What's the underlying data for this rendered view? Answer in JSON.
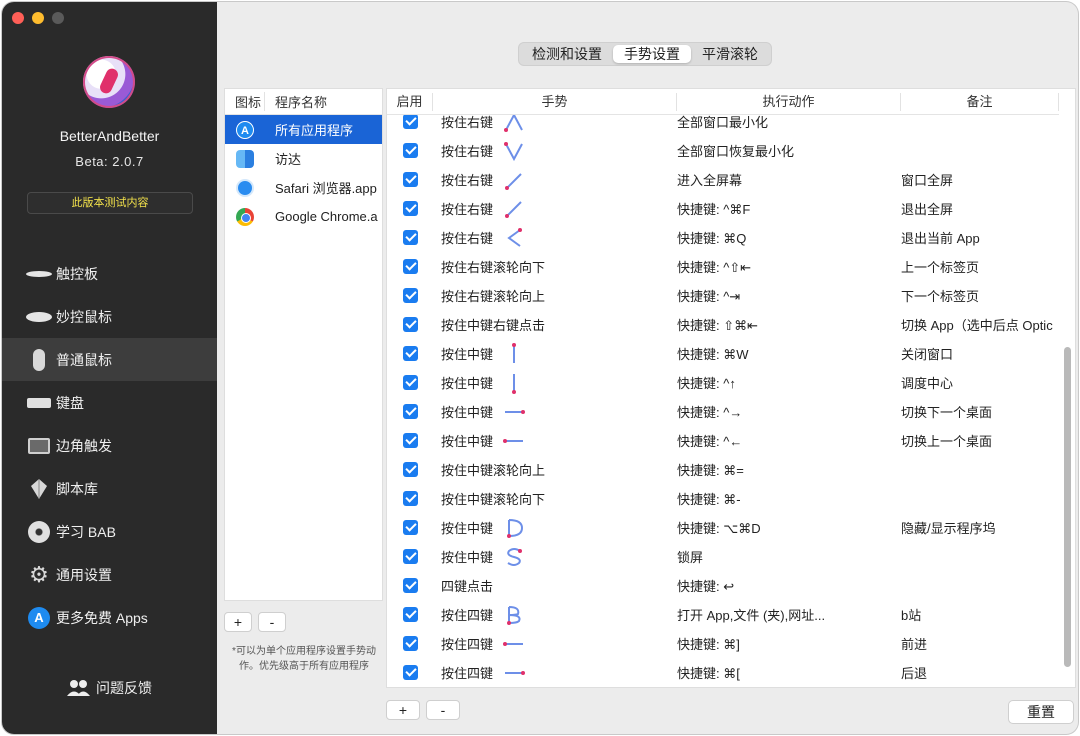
{
  "sidebar": {
    "app_name": "BetterAndBetter",
    "version": "Beta: 2.0.7",
    "test_button": "此版本测试内容",
    "items": [
      {
        "label": "触控板",
        "icon": "trackpad-icon"
      },
      {
        "label": "妙控鼠标",
        "icon": "magic-mouse-icon"
      },
      {
        "label": "普通鼠标",
        "icon": "mouse-icon",
        "active": true
      },
      {
        "label": "键盘",
        "icon": "keyboard-icon"
      },
      {
        "label": "边角触发",
        "icon": "hot-corner-icon"
      },
      {
        "label": "脚本库",
        "icon": "script-icon"
      },
      {
        "label": "学习 BAB",
        "icon": "learn-icon"
      },
      {
        "label": "通用设置",
        "icon": "gear-icon"
      },
      {
        "label": "更多免费 Apps",
        "icon": "appstore-icon"
      }
    ],
    "feedback": "问题反馈"
  },
  "tabs": [
    {
      "label": "检测和设置"
    },
    {
      "label": "手势设置",
      "active": true
    },
    {
      "label": "平滑滚轮"
    }
  ],
  "app_list": {
    "header_icon": "图标",
    "header_name": "程序名称",
    "apps": [
      {
        "name": "所有应用程序",
        "icon": "appstore-icon",
        "selected": true
      },
      {
        "name": "访达",
        "icon": "finder-icon"
      },
      {
        "name": "Safari 浏览器.app",
        "icon": "safari-icon"
      },
      {
        "name": "Google Chrome.a",
        "icon": "chrome-icon"
      }
    ],
    "add_label": "+",
    "remove_label": "-",
    "note": "*可以为单个应用程序设置手势动作。优先级高于所有应用程序"
  },
  "gesture_table": {
    "headers": {
      "enabled": "启用",
      "gesture": "手势",
      "action": "执行动作",
      "remark": "备注"
    },
    "rows": [
      {
        "gesture": "按住右键",
        "glyph": "up-v",
        "action": "全部窗口最小化",
        "remark": ""
      },
      {
        "gesture": "按住右键",
        "glyph": "down-v",
        "action": "全部窗口恢复最小化",
        "remark": ""
      },
      {
        "gesture": "按住右键",
        "glyph": "diag-up",
        "action": "进入全屏幕",
        "remark": "窗口全屏"
      },
      {
        "gesture": "按住右键",
        "glyph": "diag-down",
        "action": "快捷键: ^⌘F",
        "remark": "退出全屏"
      },
      {
        "gesture": "按住右键",
        "glyph": "left-v",
        "action": "快捷键: ⌘Q",
        "remark": "退出当前 App"
      },
      {
        "gesture": "按住右键滚轮向下",
        "glyph": "",
        "action": "快捷键: ^⇧⇤",
        "remark": "上一个标签页"
      },
      {
        "gesture": "按住右键滚轮向上",
        "glyph": "",
        "action": "快捷键: ^⇥",
        "remark": "下一个标签页"
      },
      {
        "gesture": "按住中键右键点击",
        "glyph": "",
        "action": "快捷键: ⇧⌘⇤",
        "remark": "切换 App（选中后点 Optic"
      },
      {
        "gesture": "按住中键",
        "glyph": "line-down",
        "action": "快捷键: ⌘W",
        "remark": "关闭窗口"
      },
      {
        "gesture": "按住中键",
        "glyph": "line-up",
        "action": "快捷键: ^↑",
        "remark": "调度中心"
      },
      {
        "gesture": "按住中键",
        "glyph": "line-right",
        "action": "快捷键: ^→",
        "remark": "切换下一个桌面"
      },
      {
        "gesture": "按住中键",
        "glyph": "line-left",
        "action": "快捷键: ^←",
        "remark": "切换上一个桌面"
      },
      {
        "gesture": "按住中键滚轮向上",
        "glyph": "",
        "action": "快捷键: ⌘=",
        "remark": ""
      },
      {
        "gesture": "按住中键滚轮向下",
        "glyph": "",
        "action": "快捷键: ⌘-",
        "remark": ""
      },
      {
        "gesture": "按住中键",
        "glyph": "letter-D",
        "action": "快捷键: ⌥⌘D",
        "remark": "隐藏/显示程序坞"
      },
      {
        "gesture": "按住中键",
        "glyph": "letter-S",
        "action": "锁屏",
        "remark": ""
      },
      {
        "gesture": "四键点击",
        "glyph": "",
        "action": "快捷键: ↩",
        "remark": ""
      },
      {
        "gesture": "按住四键",
        "glyph": "letter-B",
        "action": "打开 App,文件 (夹),网址...",
        "remark": "b站"
      },
      {
        "gesture": "按住四键",
        "glyph": "line-left",
        "action": "快捷键: ⌘]",
        "remark": "前进"
      },
      {
        "gesture": "按住四键",
        "glyph": "line-right",
        "action": "快捷键: ⌘[",
        "remark": "后退"
      }
    ],
    "add_label": "+",
    "remove_label": "-",
    "reset_label": "重置"
  },
  "colors": {
    "accent": "#1a64d6",
    "checkbox": "#1a7cf0",
    "gesture_stroke": "#6d8fe8",
    "gesture_dot": "#e0306b",
    "sidebar_bg": "#2a2a2a",
    "test_text": "#f2e14b"
  }
}
